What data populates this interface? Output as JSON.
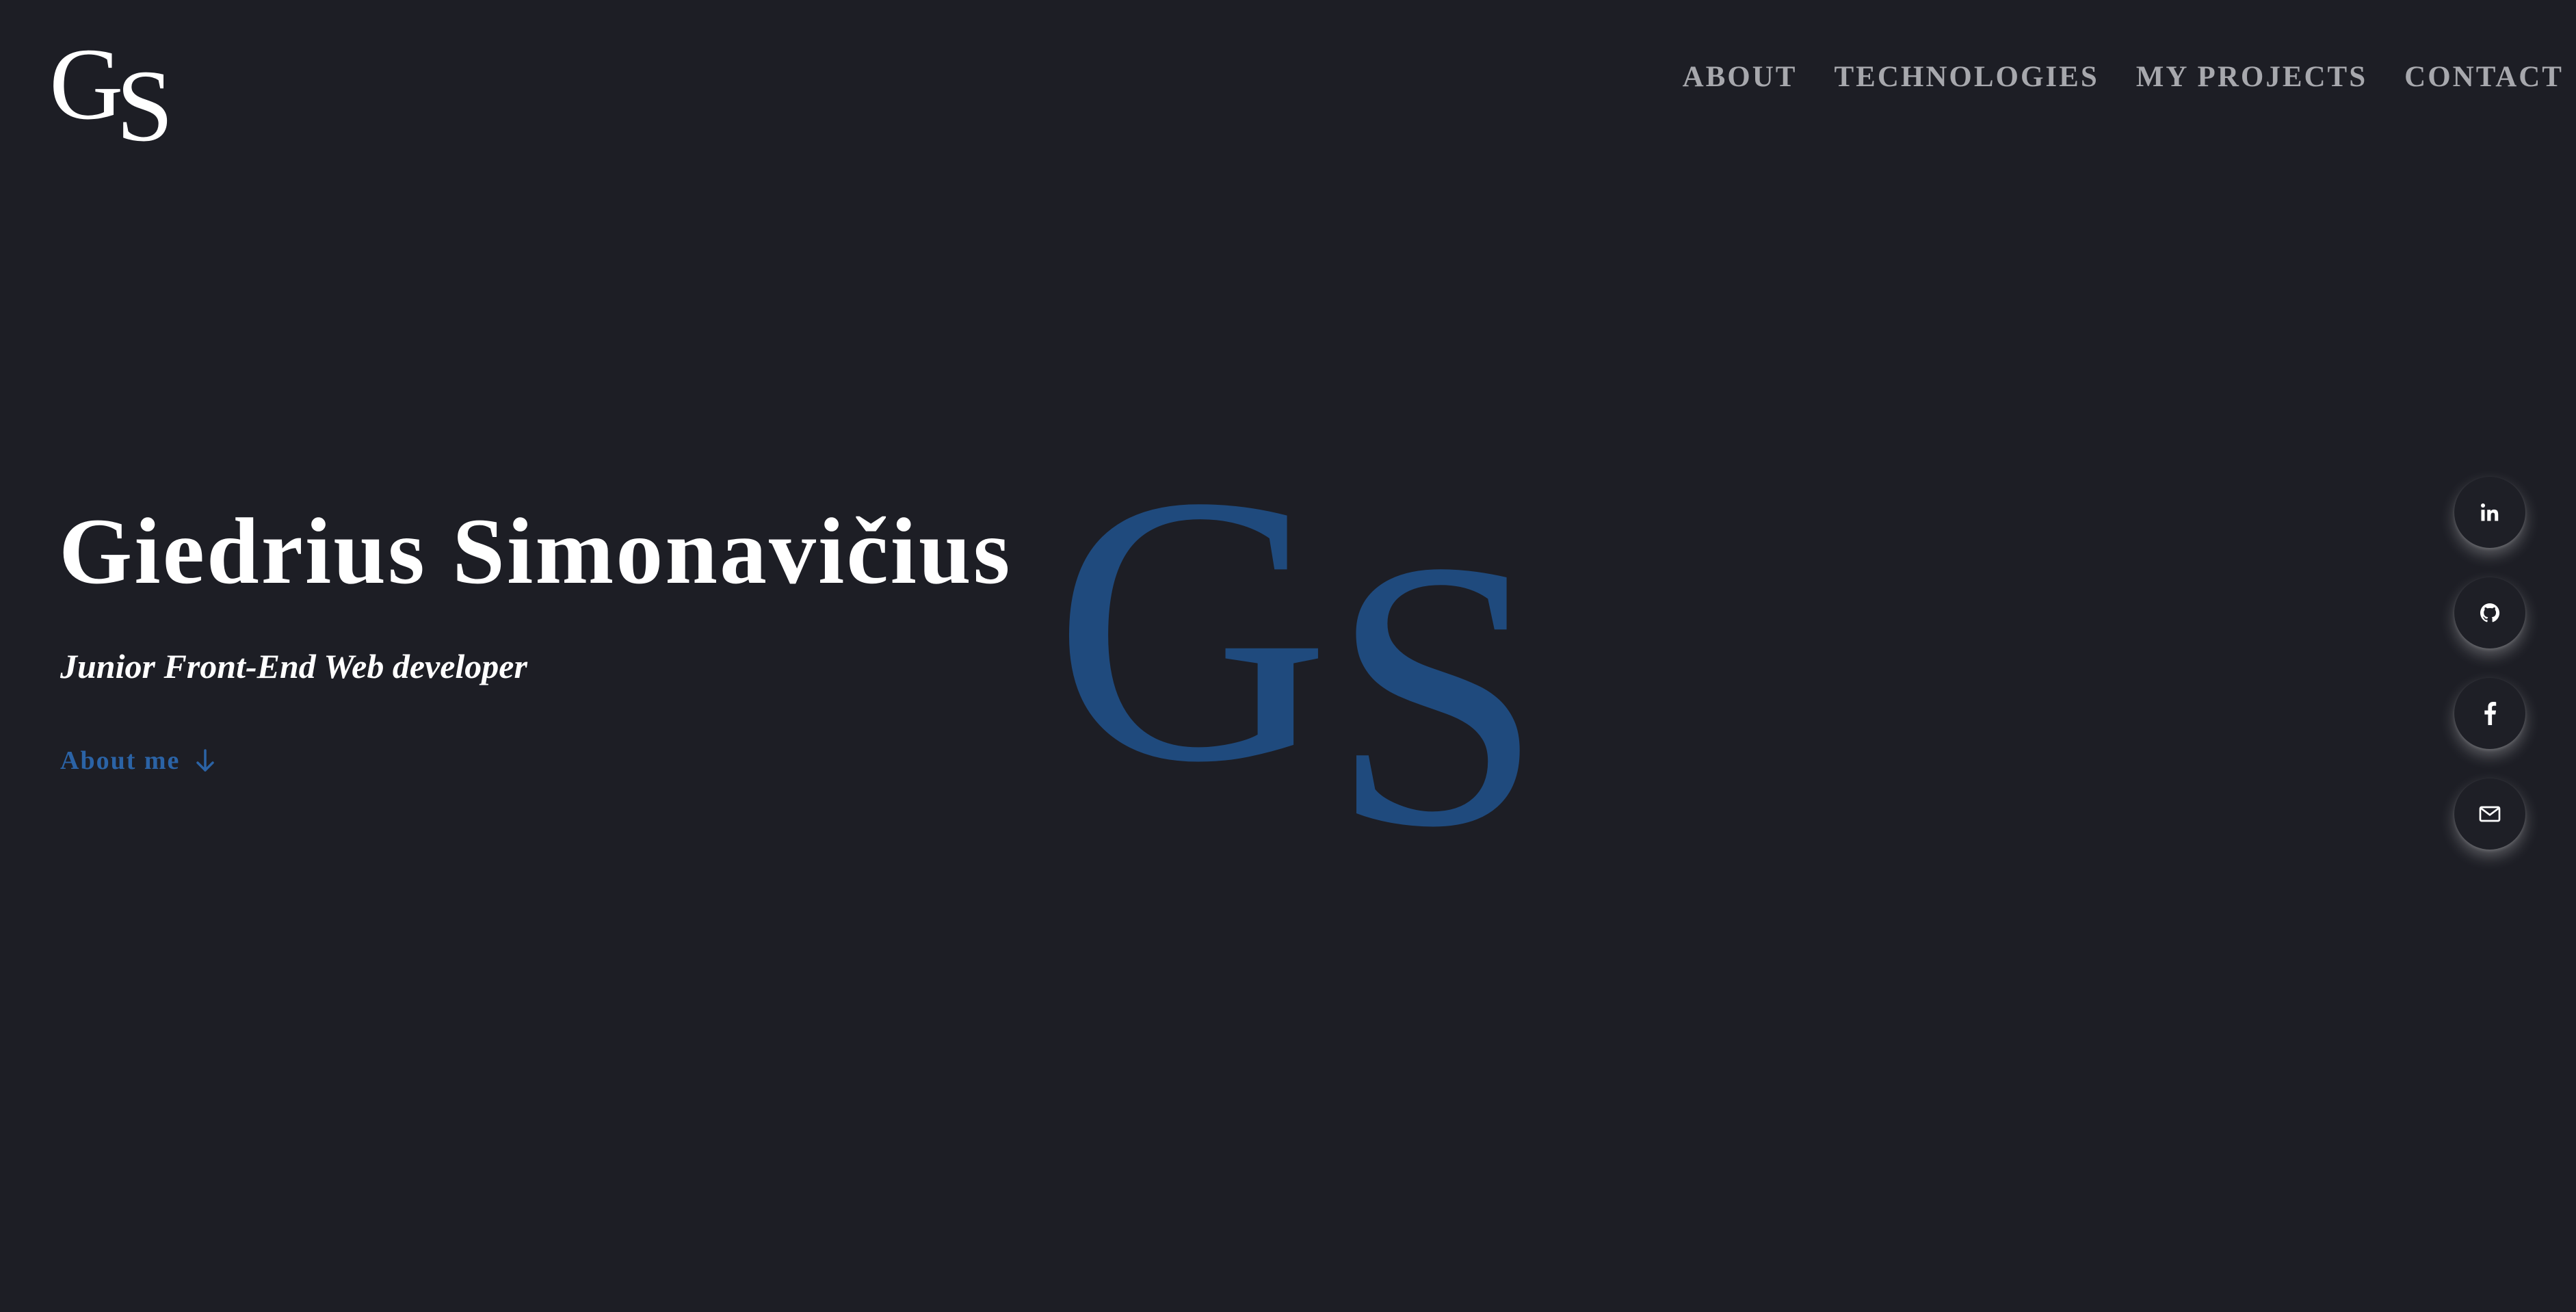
{
  "header": {
    "logo": {
      "letter_g": "G",
      "letter_s": "S"
    },
    "nav": [
      {
        "label": "ABOUT"
      },
      {
        "label": "TECHNOLOGIES"
      },
      {
        "label": "MY PROJECTS"
      },
      {
        "label": "CONTACT"
      }
    ]
  },
  "hero": {
    "name": "Giedrius Simonavičius",
    "role": "Junior Front-End Web developer",
    "about_link": {
      "label": "About me",
      "icon": "arrow-down-icon"
    },
    "monogram": {
      "letter_g": "G",
      "letter_s": "S"
    }
  },
  "social": [
    {
      "icon": "linkedin-icon"
    },
    {
      "icon": "github-icon"
    },
    {
      "icon": "facebook-icon"
    },
    {
      "icon": "mail-icon"
    }
  ],
  "colors": {
    "background": "#1d1e25",
    "text": "#ffffff",
    "nav_text": "#a7a8ad",
    "accent": "#2b63a6",
    "monogram": "#1f4a7d"
  }
}
